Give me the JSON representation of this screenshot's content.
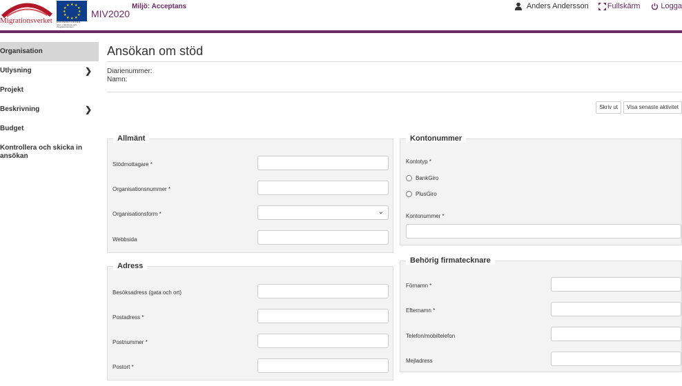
{
  "header": {
    "logo_text": "Migrationsverket",
    "eu_caption": "EUROPEISKA UNIONEN\nAsyl-, migrations- och\nintegrationsfonden",
    "app_name": "MIV2020",
    "environment": "Miljö: Acceptans",
    "user_name": "Anders Andersson",
    "fullscreen_label": "Fullskärm",
    "logout_label": "Logga",
    "accent_color": "#6a2a63"
  },
  "sidebar": {
    "items": [
      {
        "label": "Organisation",
        "active": true,
        "chevron": false
      },
      {
        "label": "Utlysning",
        "active": false,
        "chevron": true
      },
      {
        "label": "Projekt",
        "active": false,
        "chevron": false
      },
      {
        "label": "Beskrivning",
        "active": false,
        "chevron": true
      },
      {
        "label": "Budget",
        "active": false,
        "chevron": false
      },
      {
        "label": "Kontrollera och skicka in ansökan",
        "active": false,
        "chevron": false
      }
    ]
  },
  "main": {
    "title": "Ansökan om stöd",
    "diarienummer_label": "Diarienummer:",
    "namn_label": "Namn:",
    "print_button": "Skriv ut",
    "activity_button": "Visa senaste aktivitet"
  },
  "allmant": {
    "legend": "Allmänt",
    "fields": [
      {
        "label": "Stödmottagare *",
        "value": ""
      },
      {
        "label": "Organisationsnummer *",
        "value": ""
      },
      {
        "label": "Organisationsform *",
        "value": ""
      },
      {
        "label": "Webbsida",
        "value": ""
      }
    ]
  },
  "adress": {
    "legend": "Adress",
    "fields": [
      {
        "label": "Besöksadress (gata och ort)",
        "value": ""
      },
      {
        "label": "Postadress *",
        "value": ""
      },
      {
        "label": "Postnummer *",
        "value": ""
      },
      {
        "label": "Postort *",
        "value": ""
      }
    ]
  },
  "kontonummer": {
    "legend": "Kontonummer",
    "kontotyp_label": "Kontotyp *",
    "options": [
      "BankGiro",
      "PlusGiro"
    ],
    "kontonummer_label": "Kontonummer *",
    "kontonummer_value": ""
  },
  "firmatecknare": {
    "legend": "Behörig firmatecknare",
    "fields": [
      {
        "label": "Förnamn *",
        "value": ""
      },
      {
        "label": "Efternamn *",
        "value": ""
      },
      {
        "label": "Telefon/mobiltelefon",
        "value": ""
      },
      {
        "label": "Mejladress",
        "value": ""
      }
    ]
  }
}
